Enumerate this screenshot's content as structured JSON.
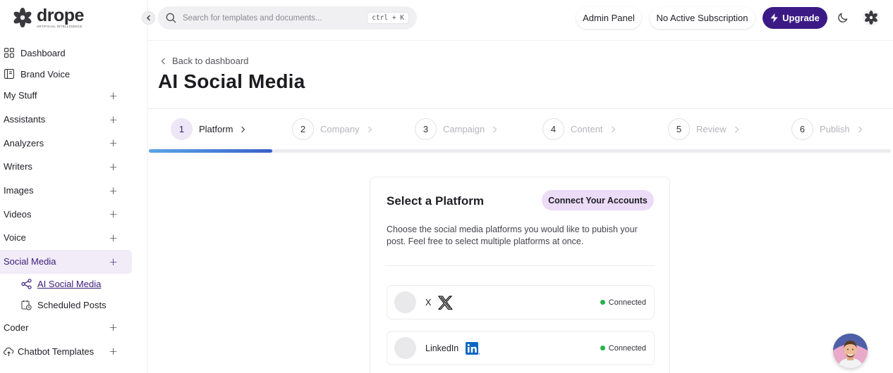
{
  "brand": {
    "name": "drope",
    "tagline": "ARTIFICIAL INTELLIGENCE"
  },
  "sidebar": {
    "top_links": [
      {
        "label": "Dashboard",
        "icon": "grid-icon"
      },
      {
        "label": "Brand Voice",
        "icon": "book-icon"
      }
    ],
    "groups": [
      {
        "label": "My Stuff",
        "expanded": false
      },
      {
        "label": "Assistants",
        "expanded": false
      },
      {
        "label": "Analyzers",
        "expanded": false
      },
      {
        "label": "Writers",
        "expanded": false
      },
      {
        "label": "Images",
        "expanded": false
      },
      {
        "label": "Videos",
        "expanded": false
      },
      {
        "label": "Voice",
        "expanded": false
      },
      {
        "label": "Social Media",
        "expanded": true,
        "active": true
      },
      {
        "label": "Coder",
        "expanded": false
      },
      {
        "label": "Chatbot Templates",
        "expanded": false
      }
    ],
    "social_media_items": [
      {
        "label": "AI Social Media",
        "current": true,
        "icon": "share-icon"
      },
      {
        "label": "Scheduled Posts",
        "current": false,
        "icon": "calendar-clock-icon"
      }
    ],
    "plus_symbol": "+"
  },
  "topbar": {
    "search_placeholder": "Search for templates and documents...",
    "search_shortcut": "ctrl + K",
    "admin_label": "Admin Panel",
    "subscription_label": "No Active Subscription",
    "upgrade_label": "Upgrade"
  },
  "page": {
    "back_label": "Back to dashboard",
    "title": "AI Social Media"
  },
  "steps": [
    {
      "num": "1",
      "label": "Platform",
      "active": true
    },
    {
      "num": "2",
      "label": "Company",
      "active": false
    },
    {
      "num": "3",
      "label": "Campaign",
      "active": false
    },
    {
      "num": "4",
      "label": "Content",
      "active": false
    },
    {
      "num": "5",
      "label": "Review",
      "active": false
    },
    {
      "num": "6",
      "label": "Publish",
      "active": false
    }
  ],
  "progress_fraction": 0.166,
  "card": {
    "title": "Select a Platform",
    "connect_label": "Connect Your Accounts",
    "description": "Choose the social media platforms you would like to pubish your post. Feel free to select multiple platforms at once.",
    "platforms": [
      {
        "name": "X",
        "status": "Connected",
        "icon": "x-logo-icon"
      },
      {
        "name": "LinkedIn",
        "status": "Connected",
        "icon": "linkedin-logo-icon"
      }
    ]
  },
  "colors": {
    "accent": "#3c1a86",
    "active_bg": "#f1ecf8",
    "connected": "#27b34b",
    "connect_btn_bg": "#ecdcf7"
  }
}
